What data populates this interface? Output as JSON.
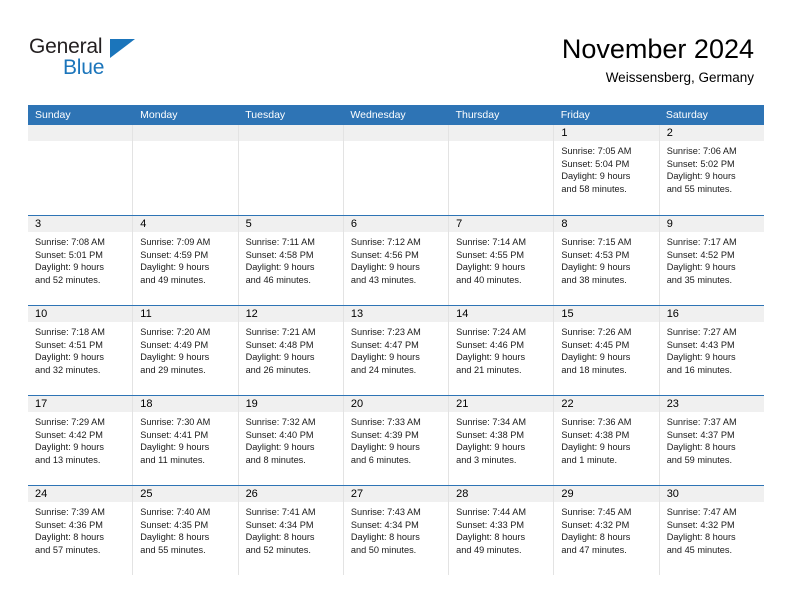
{
  "brand": {
    "name_top": "General",
    "name_bottom": "Blue"
  },
  "header": {
    "month_title": "November 2024",
    "location": "Weissensberg, Germany"
  },
  "colors": {
    "header_blue": "#2e74b5",
    "brand_blue": "#1b75bb",
    "day_band_gray": "#f0f0f0",
    "cell_divider": "#e3e3e3"
  },
  "weekdays": [
    "Sunday",
    "Monday",
    "Tuesday",
    "Wednesday",
    "Thursday",
    "Friday",
    "Saturday"
  ],
  "weeks": [
    [
      {
        "day": "",
        "sunrise": "",
        "sunset": "",
        "daylight_line1": "",
        "daylight_line2": ""
      },
      {
        "day": "",
        "sunrise": "",
        "sunset": "",
        "daylight_line1": "",
        "daylight_line2": ""
      },
      {
        "day": "",
        "sunrise": "",
        "sunset": "",
        "daylight_line1": "",
        "daylight_line2": ""
      },
      {
        "day": "",
        "sunrise": "",
        "sunset": "",
        "daylight_line1": "",
        "daylight_line2": ""
      },
      {
        "day": "",
        "sunrise": "",
        "sunset": "",
        "daylight_line1": "",
        "daylight_line2": ""
      },
      {
        "day": "1",
        "sunrise": "Sunrise: 7:05 AM",
        "sunset": "Sunset: 5:04 PM",
        "daylight_line1": "Daylight: 9 hours",
        "daylight_line2": "and 58 minutes."
      },
      {
        "day": "2",
        "sunrise": "Sunrise: 7:06 AM",
        "sunset": "Sunset: 5:02 PM",
        "daylight_line1": "Daylight: 9 hours",
        "daylight_line2": "and 55 minutes."
      }
    ],
    [
      {
        "day": "3",
        "sunrise": "Sunrise: 7:08 AM",
        "sunset": "Sunset: 5:01 PM",
        "daylight_line1": "Daylight: 9 hours",
        "daylight_line2": "and 52 minutes."
      },
      {
        "day": "4",
        "sunrise": "Sunrise: 7:09 AM",
        "sunset": "Sunset: 4:59 PM",
        "daylight_line1": "Daylight: 9 hours",
        "daylight_line2": "and 49 minutes."
      },
      {
        "day": "5",
        "sunrise": "Sunrise: 7:11 AM",
        "sunset": "Sunset: 4:58 PM",
        "daylight_line1": "Daylight: 9 hours",
        "daylight_line2": "and 46 minutes."
      },
      {
        "day": "6",
        "sunrise": "Sunrise: 7:12 AM",
        "sunset": "Sunset: 4:56 PM",
        "daylight_line1": "Daylight: 9 hours",
        "daylight_line2": "and 43 minutes."
      },
      {
        "day": "7",
        "sunrise": "Sunrise: 7:14 AM",
        "sunset": "Sunset: 4:55 PM",
        "daylight_line1": "Daylight: 9 hours",
        "daylight_line2": "and 40 minutes."
      },
      {
        "day": "8",
        "sunrise": "Sunrise: 7:15 AM",
        "sunset": "Sunset: 4:53 PM",
        "daylight_line1": "Daylight: 9 hours",
        "daylight_line2": "and 38 minutes."
      },
      {
        "day": "9",
        "sunrise": "Sunrise: 7:17 AM",
        "sunset": "Sunset: 4:52 PM",
        "daylight_line1": "Daylight: 9 hours",
        "daylight_line2": "and 35 minutes."
      }
    ],
    [
      {
        "day": "10",
        "sunrise": "Sunrise: 7:18 AM",
        "sunset": "Sunset: 4:51 PM",
        "daylight_line1": "Daylight: 9 hours",
        "daylight_line2": "and 32 minutes."
      },
      {
        "day": "11",
        "sunrise": "Sunrise: 7:20 AM",
        "sunset": "Sunset: 4:49 PM",
        "daylight_line1": "Daylight: 9 hours",
        "daylight_line2": "and 29 minutes."
      },
      {
        "day": "12",
        "sunrise": "Sunrise: 7:21 AM",
        "sunset": "Sunset: 4:48 PM",
        "daylight_line1": "Daylight: 9 hours",
        "daylight_line2": "and 26 minutes."
      },
      {
        "day": "13",
        "sunrise": "Sunrise: 7:23 AM",
        "sunset": "Sunset: 4:47 PM",
        "daylight_line1": "Daylight: 9 hours",
        "daylight_line2": "and 24 minutes."
      },
      {
        "day": "14",
        "sunrise": "Sunrise: 7:24 AM",
        "sunset": "Sunset: 4:46 PM",
        "daylight_line1": "Daylight: 9 hours",
        "daylight_line2": "and 21 minutes."
      },
      {
        "day": "15",
        "sunrise": "Sunrise: 7:26 AM",
        "sunset": "Sunset: 4:45 PM",
        "daylight_line1": "Daylight: 9 hours",
        "daylight_line2": "and 18 minutes."
      },
      {
        "day": "16",
        "sunrise": "Sunrise: 7:27 AM",
        "sunset": "Sunset: 4:43 PM",
        "daylight_line1": "Daylight: 9 hours",
        "daylight_line2": "and 16 minutes."
      }
    ],
    [
      {
        "day": "17",
        "sunrise": "Sunrise: 7:29 AM",
        "sunset": "Sunset: 4:42 PM",
        "daylight_line1": "Daylight: 9 hours",
        "daylight_line2": "and 13 minutes."
      },
      {
        "day": "18",
        "sunrise": "Sunrise: 7:30 AM",
        "sunset": "Sunset: 4:41 PM",
        "daylight_line1": "Daylight: 9 hours",
        "daylight_line2": "and 11 minutes."
      },
      {
        "day": "19",
        "sunrise": "Sunrise: 7:32 AM",
        "sunset": "Sunset: 4:40 PM",
        "daylight_line1": "Daylight: 9 hours",
        "daylight_line2": "and 8 minutes."
      },
      {
        "day": "20",
        "sunrise": "Sunrise: 7:33 AM",
        "sunset": "Sunset: 4:39 PM",
        "daylight_line1": "Daylight: 9 hours",
        "daylight_line2": "and 6 minutes."
      },
      {
        "day": "21",
        "sunrise": "Sunrise: 7:34 AM",
        "sunset": "Sunset: 4:38 PM",
        "daylight_line1": "Daylight: 9 hours",
        "daylight_line2": "and 3 minutes."
      },
      {
        "day": "22",
        "sunrise": "Sunrise: 7:36 AM",
        "sunset": "Sunset: 4:38 PM",
        "daylight_line1": "Daylight: 9 hours",
        "daylight_line2": "and 1 minute."
      },
      {
        "day": "23",
        "sunrise": "Sunrise: 7:37 AM",
        "sunset": "Sunset: 4:37 PM",
        "daylight_line1": "Daylight: 8 hours",
        "daylight_line2": "and 59 minutes."
      }
    ],
    [
      {
        "day": "24",
        "sunrise": "Sunrise: 7:39 AM",
        "sunset": "Sunset: 4:36 PM",
        "daylight_line1": "Daylight: 8 hours",
        "daylight_line2": "and 57 minutes."
      },
      {
        "day": "25",
        "sunrise": "Sunrise: 7:40 AM",
        "sunset": "Sunset: 4:35 PM",
        "daylight_line1": "Daylight: 8 hours",
        "daylight_line2": "and 55 minutes."
      },
      {
        "day": "26",
        "sunrise": "Sunrise: 7:41 AM",
        "sunset": "Sunset: 4:34 PM",
        "daylight_line1": "Daylight: 8 hours",
        "daylight_line2": "and 52 minutes."
      },
      {
        "day": "27",
        "sunrise": "Sunrise: 7:43 AM",
        "sunset": "Sunset: 4:34 PM",
        "daylight_line1": "Daylight: 8 hours",
        "daylight_line2": "and 50 minutes."
      },
      {
        "day": "28",
        "sunrise": "Sunrise: 7:44 AM",
        "sunset": "Sunset: 4:33 PM",
        "daylight_line1": "Daylight: 8 hours",
        "daylight_line2": "and 49 minutes."
      },
      {
        "day": "29",
        "sunrise": "Sunrise: 7:45 AM",
        "sunset": "Sunset: 4:32 PM",
        "daylight_line1": "Daylight: 8 hours",
        "daylight_line2": "and 47 minutes."
      },
      {
        "day": "30",
        "sunrise": "Sunrise: 7:47 AM",
        "sunset": "Sunset: 4:32 PM",
        "daylight_line1": "Daylight: 8 hours",
        "daylight_line2": "and 45 minutes."
      }
    ]
  ]
}
